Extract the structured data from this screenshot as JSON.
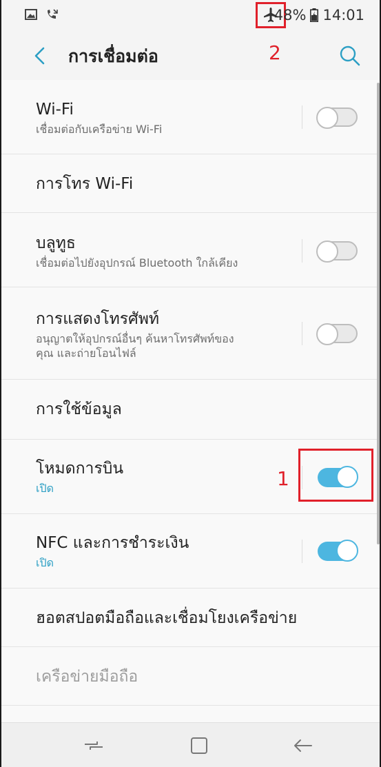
{
  "status_bar": {
    "battery": "48%",
    "time": "14:01",
    "left_icons": [
      "gallery-icon",
      "missed-call-icon"
    ],
    "airplane_icon": "airplane-mode-icon"
  },
  "app_bar": {
    "title": "การเชื่อมต่อ",
    "back_icon": "back-arrow-icon",
    "search_icon": "search-icon"
  },
  "annotations": {
    "marker_1": "1",
    "marker_2": "2",
    "color": "#e0202a"
  },
  "settings": [
    {
      "title": "Wi-Fi",
      "subtitle": "เชื่อมต่อกับเครือข่าย Wi-Fi",
      "toggle": "off"
    },
    {
      "title": "การโทร Wi-Fi"
    },
    {
      "title": "บลูทูธ",
      "subtitle": "เชื่อมต่อไปยังอุปกรณ์ Bluetooth ใกล้เคียง",
      "toggle": "off"
    },
    {
      "title": "การแสดงโทรศัพท์",
      "subtitle": "อนุญาตให้อุปกรณ์อื่นๆ ค้นหาโทรศัพท์ของ",
      "subtitle2": "คุณ และถ่ายโอนไฟล์",
      "toggle": "off"
    },
    {
      "title": "การใช้ข้อมูล"
    },
    {
      "title": "โหมดการบิน",
      "subtitle": "เปิด",
      "toggle": "on"
    },
    {
      "title": "NFC และการชำระเงิน",
      "subtitle": "เปิด",
      "toggle": "on"
    },
    {
      "title": "ฮอตสปอตมือถือและเชื่อมโยงเครือข่าย"
    },
    {
      "title": "เครือข่ายมือถือ",
      "disabled": true
    }
  ],
  "nav_bar": {
    "recent_icon": "recent-apps-icon",
    "home_icon": "home-icon",
    "back_icon": "back-nav-icon"
  },
  "colors": {
    "accent": "#4db6e0",
    "on_text": "#2c9fc4",
    "background": "#f9f9f9"
  }
}
